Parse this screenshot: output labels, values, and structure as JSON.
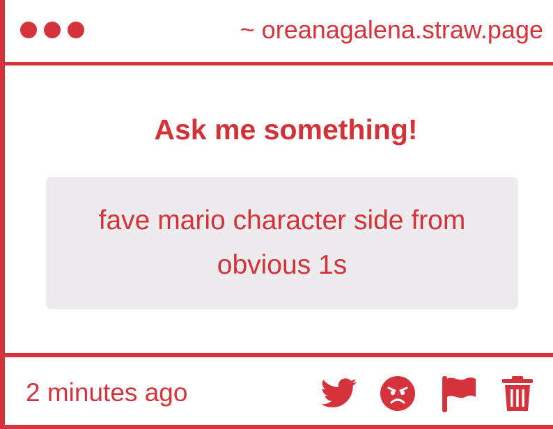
{
  "window": {
    "controls": [
      "dot",
      "dot",
      "dot"
    ],
    "site_url": "~ oreanagalena.straw.page"
  },
  "main": {
    "title": "Ask me something!",
    "question": "fave mario character side from obvious 1s"
  },
  "footer": {
    "timestamp": "2 minutes ago",
    "actions": [
      {
        "icon": "twitter-icon"
      },
      {
        "icon": "angry-face-icon"
      },
      {
        "icon": "flag-icon"
      },
      {
        "icon": "trash-icon"
      }
    ]
  },
  "colors": {
    "accent": "#d4333c",
    "question_background": "#edebed",
    "background": "#ffffff"
  }
}
